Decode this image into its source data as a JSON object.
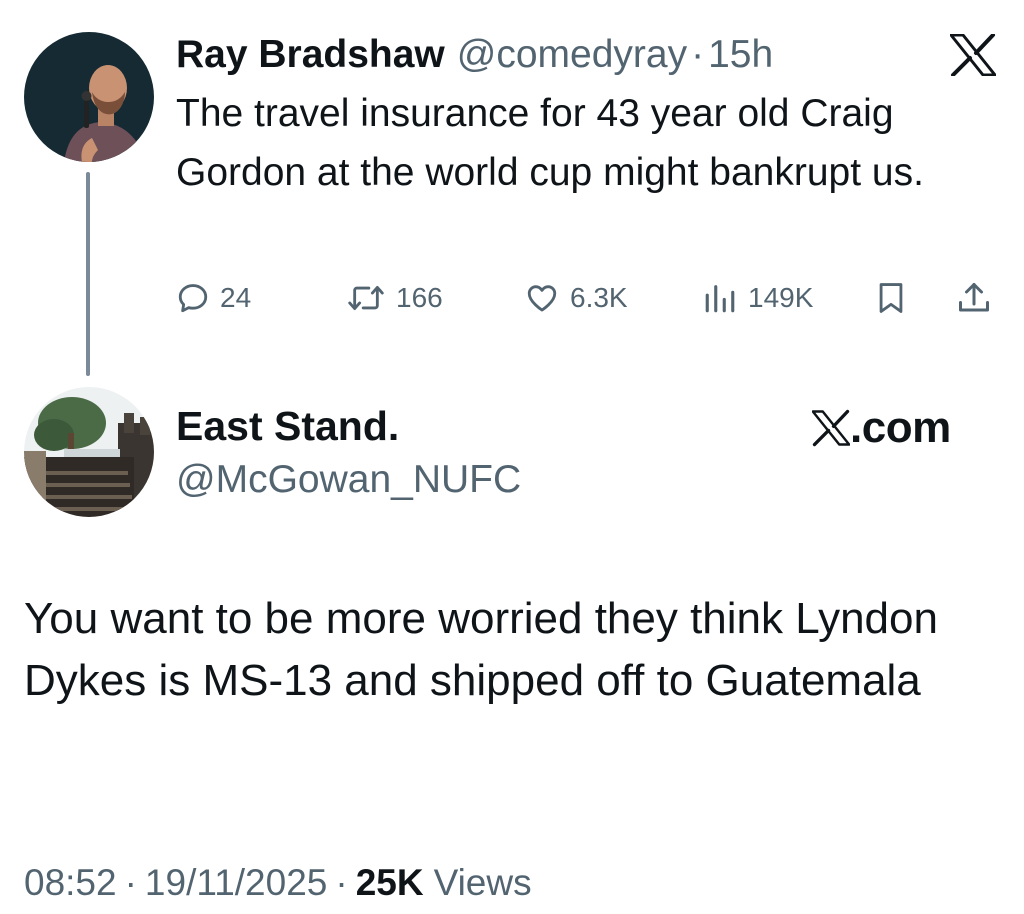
{
  "original_tweet": {
    "author_name": "Ray Bradshaw",
    "handle": "@comedyray",
    "separator": "·",
    "time_ago": "15h",
    "text": "The travel insurance for 43 year old Craig Gordon at the world cup might bankrupt us.",
    "platform_icon": "x-logo-icon",
    "actions": {
      "replies": "24",
      "retweets": "166",
      "likes": "6.3K",
      "views": "149K"
    },
    "icons": {
      "reply": "reply-icon",
      "retweet": "retweet-icon",
      "like": "heart-icon",
      "views": "views-bar-icon",
      "bookmark": "bookmark-icon",
      "share": "share-icon"
    }
  },
  "reply_tweet": {
    "author_name": "East Stand.",
    "handle": "@McGowan_NUFC",
    "platform_label": ".com",
    "platform_icon": "x-logo-icon",
    "text": "You want to be more worried they think Lyndon Dykes is MS-13 and shipped off to Guatemala",
    "time": "08:52",
    "date": "19/11/2025",
    "separator": "·",
    "views_count": "25K",
    "views_label": "Views"
  },
  "colors": {
    "text_primary": "#0f1419",
    "text_secondary": "#536471",
    "thread_line": "#7b8a99",
    "background": "#ffffff"
  }
}
